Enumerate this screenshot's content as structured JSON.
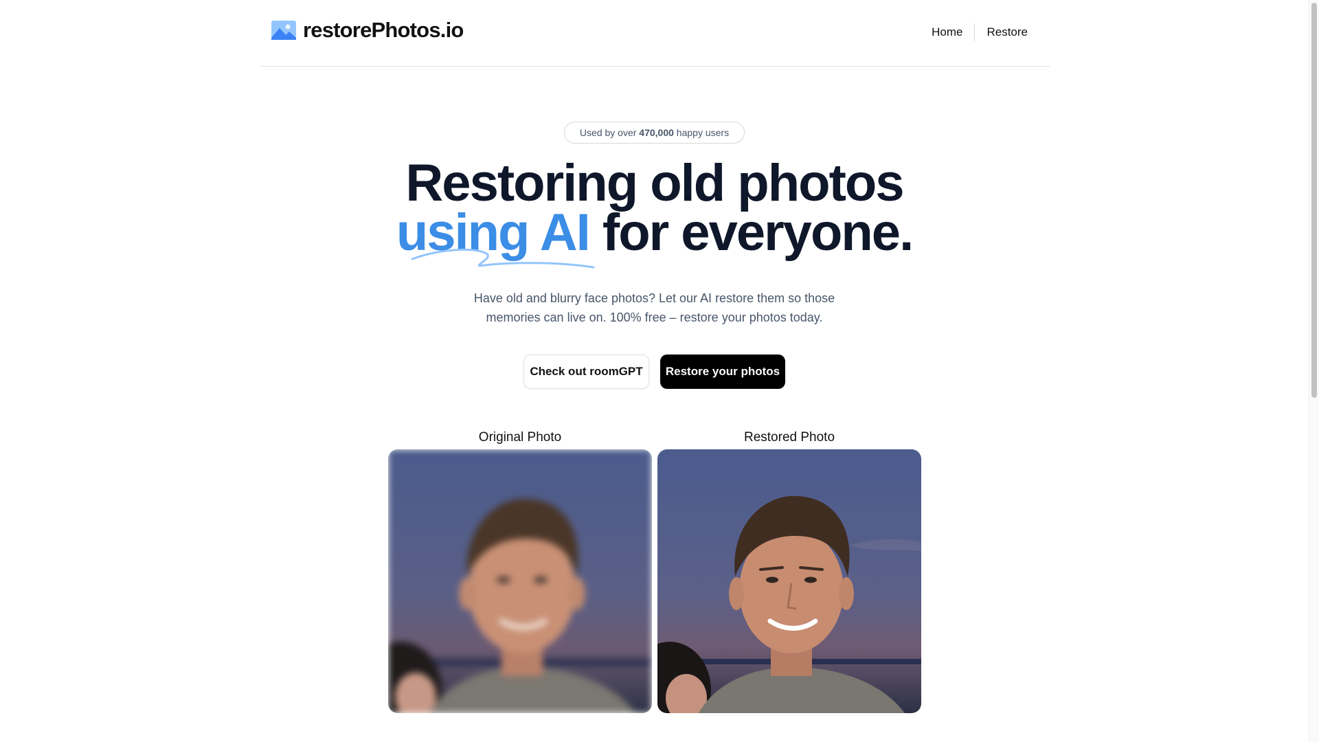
{
  "header": {
    "logo_text": "restorePhotos.io",
    "nav": [
      {
        "label": "Home"
      },
      {
        "label": "Restore"
      }
    ]
  },
  "hero": {
    "badge": {
      "prefix": "Used by over ",
      "count": "470,000",
      "suffix": " happy users"
    },
    "headline_line1": "Restoring old photos",
    "headline_accent": "using AI",
    "headline_rest": " for everyone.",
    "subtitle_line1": "Have old and blurry face photos? Let our AI restore them so those",
    "subtitle_line2": "memories can live on. 100% free – restore your photos today.",
    "secondary_button": "Check out roomGPT",
    "primary_button": "Restore your photos"
  },
  "comparison": {
    "original_label": "Original Photo",
    "restored_label": "Restored Photo"
  },
  "colors": {
    "accent": "#3b8de6",
    "primary_button_bg": "#000000",
    "text_dark": "#0f172a",
    "text_muted": "#475569"
  },
  "icons": [
    "image-icon"
  ]
}
